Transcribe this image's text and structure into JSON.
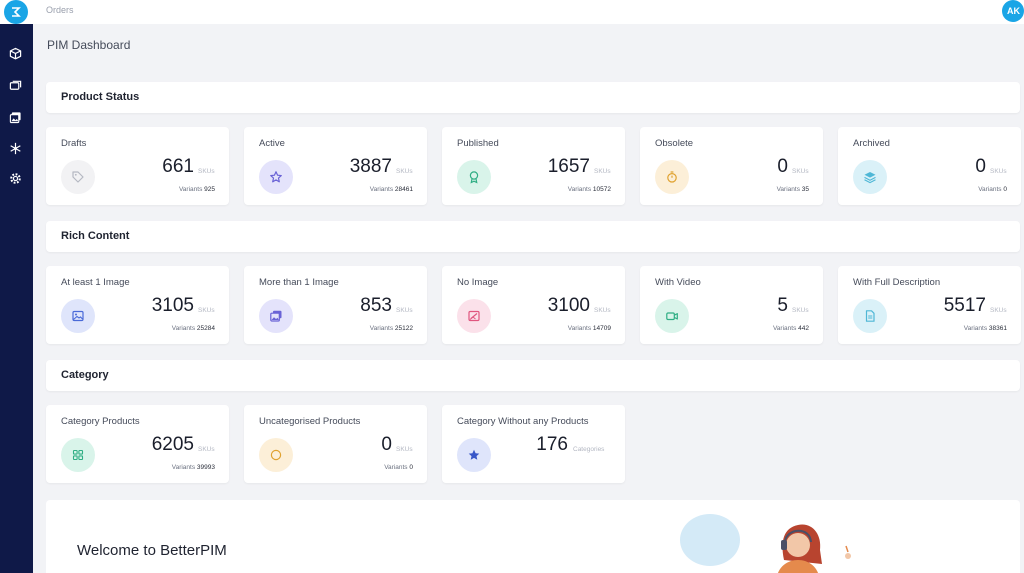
{
  "app": {
    "breadcrumb": "Orders",
    "user_initials": "AK",
    "accent": "#1aa5e6",
    "sidebar_color": "#0f1948"
  },
  "sidebar": {
    "items": [
      {
        "icon": "cube-icon"
      },
      {
        "icon": "folders-icon"
      },
      {
        "icon": "images-icon"
      },
      {
        "icon": "snowflake-icon"
      },
      {
        "icon": "settings-gear-icon"
      }
    ]
  },
  "page": {
    "title": "PIM Dashboard"
  },
  "sections": {
    "product_status": {
      "title": "Product Status",
      "cards": [
        {
          "label": "Drafts",
          "value": "661",
          "unit": "SKUs",
          "variants_label": "Variants",
          "variants": "925",
          "icon": "tag-icon",
          "color": "#f0f0f0"
        },
        {
          "label": "Active",
          "value": "3887",
          "unit": "SKUs",
          "variants_label": "Variants",
          "variants": "28461",
          "icon": "star-icon",
          "color": "#e4e3fb"
        },
        {
          "label": "Published",
          "value": "1657",
          "unit": "SKUs",
          "variants_label": "Variants",
          "variants": "10572",
          "icon": "award-icon",
          "color": "#d9f4ea"
        },
        {
          "label": "Obsolete",
          "value": "0",
          "unit": "SKUs",
          "variants_label": "Variants",
          "variants": "35",
          "icon": "timer-icon",
          "color": "#fcefd8"
        },
        {
          "label": "Archived",
          "value": "0",
          "unit": "SKUs",
          "variants_label": "Variants",
          "variants": "0",
          "icon": "layers-icon",
          "color": "#daf1f8"
        }
      ]
    },
    "rich_content": {
      "title": "Rich Content",
      "cards": [
        {
          "label": "At least 1 Image",
          "value": "3105",
          "unit": "SKUs",
          "variants_label": "Variants",
          "variants": "25284",
          "icon": "image-icon",
          "color": "#dfe5fb"
        },
        {
          "label": "More than 1 Image",
          "value": "853",
          "unit": "SKUs",
          "variants_label": "Variants",
          "variants": "25122",
          "icon": "images-icon",
          "color": "#e4e3fb"
        },
        {
          "label": "No Image",
          "value": "3100",
          "unit": "SKUs",
          "variants_label": "Variants",
          "variants": "14709",
          "icon": "no-image-icon",
          "color": "#fbe1ea"
        },
        {
          "label": "With Video",
          "value": "5",
          "unit": "SKUs",
          "variants_label": "Variants",
          "variants": "442",
          "icon": "video-icon",
          "color": "#d9f4ea"
        },
        {
          "label": "With Full Description",
          "value": "5517",
          "unit": "SKUs",
          "variants_label": "Variants",
          "variants": "38361",
          "icon": "document-icon",
          "color": "#daf1f8"
        }
      ]
    },
    "category": {
      "title": "Category",
      "cards": [
        {
          "label": "Category Products",
          "value": "6205",
          "unit": "SKUs",
          "variants_label": "Variants",
          "variants": "39993",
          "icon": "grid-icon",
          "color": "#d9f4ea"
        },
        {
          "label": "Uncategorised Products",
          "value": "0",
          "unit": "SKUs",
          "variants_label": "Variants",
          "variants": "0",
          "icon": "circle-icon",
          "color": "#fcefd8"
        },
        {
          "label": "Category Without any Products",
          "value": "176",
          "unit": "Categories",
          "icon": "star-icon",
          "color": "#dfe5fb"
        }
      ]
    }
  },
  "welcome": {
    "title": "Welcome to BetterPIM"
  }
}
